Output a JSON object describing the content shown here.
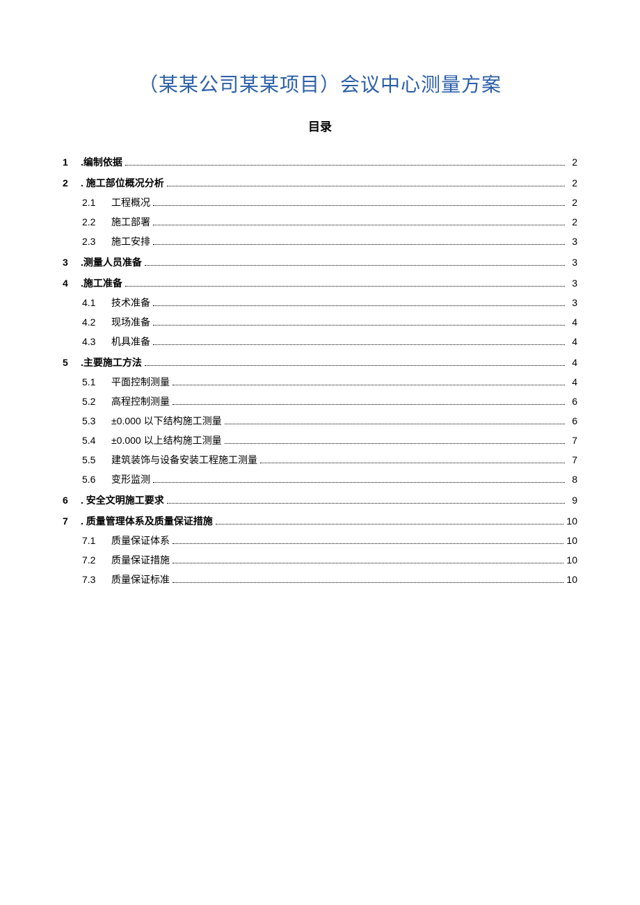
{
  "title": "（某某公司某某项目）会议中心测量方案",
  "toc_heading": "目录",
  "sections": [
    {
      "num": "1",
      "label": ".编制依据",
      "page": "2",
      "children": []
    },
    {
      "num": "2",
      "label": ". 施工部位概况分析",
      "page": "2",
      "children": [
        {
          "num": "2.1",
          "label": "工程概况",
          "page": "2"
        },
        {
          "num": "2.2",
          "label": "施工部署",
          "page": "2"
        },
        {
          "num": "2.3",
          "label": "施工安排",
          "page": "3"
        }
      ]
    },
    {
      "num": "3",
      "label": ".测量人员准备",
      "page": "3",
      "children": []
    },
    {
      "num": "4",
      "label": ".施工准备",
      "page": "3",
      "children": [
        {
          "num": "4.1",
          "label": "技术准备",
          "page": "3"
        },
        {
          "num": "4.2",
          "label": "现场准备",
          "page": "4"
        },
        {
          "num": "4.3",
          "label": "机具准备",
          "page": "4"
        }
      ]
    },
    {
      "num": "5",
      "label": ".主要施工方法",
      "page": "4",
      "children": [
        {
          "num": "5.1",
          "label": "平面控制测量",
          "page": "4"
        },
        {
          "num": "5.2",
          "label": "高程控制测量",
          "page": "6"
        },
        {
          "num": "5.3",
          "label": "±0.000 以下结构施工测量",
          "page": "6"
        },
        {
          "num": "5.4",
          "label": "±0.000 以上结构施工测量",
          "page": "7"
        },
        {
          "num": "5.5",
          "label": "建筑装饰与设备安装工程施工测量",
          "page": "7"
        },
        {
          "num": "5.6",
          "label": "变形监测",
          "page": "8"
        }
      ]
    },
    {
      "num": "6",
      "label": ". 安全文明施工要求",
      "page": "9",
      "children": []
    },
    {
      "num": "7",
      "label": ". 质量管理体系及质量保证措施",
      "page": "10",
      "children": [
        {
          "num": "7.1",
          "label": "质量保证体系",
          "page": "10"
        },
        {
          "num": "7.2",
          "label": "质量保证措施",
          "page": "10"
        },
        {
          "num": "7.3",
          "label": "质量保证标准",
          "page": "10"
        }
      ]
    }
  ]
}
